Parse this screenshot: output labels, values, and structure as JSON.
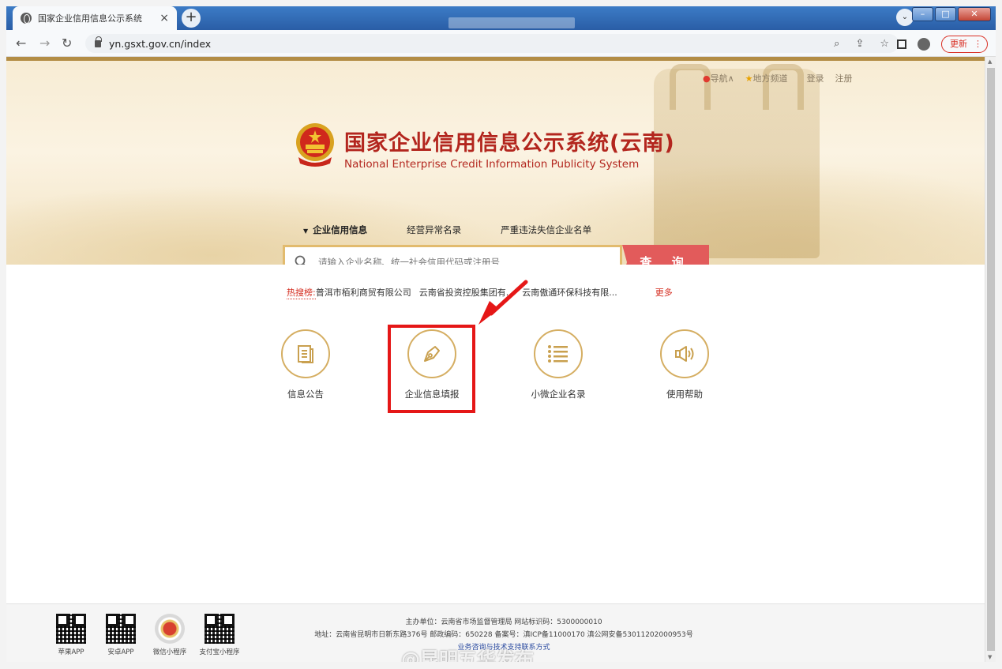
{
  "browser": {
    "tab_title": "国家企业信用信息公示系统",
    "url": "yn.gsxt.gov.cn/index",
    "update_label": "更新"
  },
  "header": {
    "nav_label": "导航",
    "local_label": "地方频道",
    "login_label": "登录",
    "register_label": "注册",
    "title_cn": "国家企业信用信息公示系统(云南)",
    "title_en": "National Enterprise Credit Information Publicity System"
  },
  "search": {
    "tabs": [
      "企业信用信息",
      "经营异常名录",
      "严重违法失信企业名单"
    ],
    "placeholder": "请输入企业名称、统一社会信用代码或注册号",
    "button_label": "查 询",
    "hot_label": "热搜榜:",
    "hot_items": [
      "普洱市栢利商贸有限公司",
      "云南省投资控股集团有...",
      "云南傲通环保科技有限..."
    ],
    "more_label": "更多"
  },
  "services": [
    {
      "label": "信息公告",
      "icon": "document-icon"
    },
    {
      "label": "企业信息填报",
      "icon": "pen-icon"
    },
    {
      "label": "小微企业名录",
      "icon": "list-icon"
    },
    {
      "label": "使用帮助",
      "icon": "speaker-icon"
    }
  ],
  "footer": {
    "qr_items": [
      "苹果APP",
      "安卓APP",
      "微信小程序",
      "支付宝小程序"
    ],
    "line1": "主办单位：云南省市场监督管理局 网站标识码：5300000010",
    "line2": "地址：云南省昆明市日新东路376号  邮政编码：650228  备案号：滇ICP备11000170 滇公网安备53011202000953号",
    "line3": "业务咨询与技术支持联系方式",
    "watermark": "@昆明五华发布"
  },
  "colors": {
    "brand_red": "#b3261e",
    "gold": "#d5ae62",
    "search_button": "#e25b5b",
    "highlight": "#e51717"
  }
}
